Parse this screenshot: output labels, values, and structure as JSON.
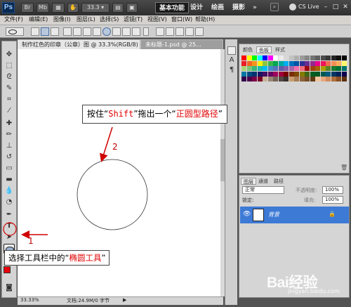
{
  "appbar": {
    "logo": "Ps",
    "zoom": "33.3",
    "workspaces": [
      "基本功能",
      "设计",
      "绘画",
      "摄影"
    ],
    "more": "»",
    "cslive": "CS Live"
  },
  "menubar": [
    "文件(F)",
    "编辑(E)",
    "图像(I)",
    "图层(L)",
    "选择(S)",
    "滤镜(T)",
    "视图(V)",
    "窗口(W)",
    "帮助(H)"
  ],
  "document": {
    "tab_active": "制作红色的印章（公章）图 @ 33.3%(RGB/8) *",
    "tab_inactive": "未标题-1.psd @ 25..."
  },
  "status": {
    "zoom": "33.33%",
    "doc_size": "文档:24.9M/0 字节"
  },
  "swatches_panel": {
    "tabs": [
      "颜色",
      "色板",
      "样式"
    ],
    "active_tab": "色板",
    "colors": [
      "#ff0000",
      "#ffff00",
      "#00ff00",
      "#00ffff",
      "#0000ff",
      "#ff00ff",
      "#ffffff",
      "#ebebeb",
      "#d7d7d7",
      "#c3c3c3",
      "#afafaf",
      "#9b9b9b",
      "#878787",
      "#737373",
      "#5f5f5f",
      "#4b4b4b",
      "#373737",
      "#232323",
      "#0f0f0f",
      "#000000",
      "#ed1c24",
      "#f26522",
      "#f7941d",
      "#fff200",
      "#8dc63f",
      "#39b54a",
      "#00a651",
      "#00a99d",
      "#00aeef",
      "#0072bc",
      "#0054a6",
      "#2e3192",
      "#662d91",
      "#92278f",
      "#ec008c",
      "#ed145b",
      "#f26c4f",
      "#f68e56",
      "#fbaf5d",
      "#fff568",
      "#acd373",
      "#7cc576",
      "#3bb878",
      "#1abbb4",
      "#00bff3",
      "#438ccb",
      "#5574b9",
      "#605ca8",
      "#855fa8",
      "#a763a9",
      "#f06ea9",
      "#f26d7d",
      "#9e0b0f",
      "#a0410d",
      "#a36209",
      "#aba000",
      "#598527",
      "#1a7b30",
      "#007236",
      "#00746b",
      "#0076a3",
      "#004a80",
      "#003471",
      "#1b1464",
      "#440e62",
      "#630460",
      "#9e005d",
      "#9e0039",
      "#790000",
      "#7b2e00",
      "#7d4900",
      "#827b00",
      "#406618",
      "#005e20",
      "#005826",
      "#005952",
      "#005b7f",
      "#003663",
      "#002157",
      "#0d004c",
      "#32004b",
      "#4b0049",
      "#7b0046",
      "#7a0026",
      "#c7b299",
      "#998675",
      "#736357",
      "#534741",
      "#37302d",
      "#c69c6d",
      "#a67c52",
      "#8c6239",
      "#754c24",
      "#603913",
      "#f2c6a0",
      "#e8a87c",
      "#d08c5c",
      "#b06e3c",
      "#8a4f22",
      "#5c3010"
    ]
  },
  "layers_panel": {
    "tabs": [
      "图层",
      "通道",
      "路径"
    ],
    "blend_mode": "正常",
    "opacity_label": "不透明度:",
    "opacity": "100%",
    "lock_label": "锁定:",
    "fill_label": "填充:",
    "fill": "100%",
    "layer_name": "背景"
  },
  "annotations": {
    "top_prefix": "按住“",
    "top_key": "Shift",
    "top_middle": "”拖出一个“",
    "top_highlight": "正圆型路径",
    "top_suffix": "”",
    "bottom_prefix": "选择工具栏中的“",
    "bottom_highlight": "椭圆工具",
    "bottom_suffix": "”",
    "step1": "1",
    "step2": "2"
  },
  "watermark": {
    "brand": "Bai经验",
    "url": "jingyan.baidu.com"
  },
  "colors": {
    "foreground": "#e8000b",
    "background": "#ffffff",
    "accent_red": "#e00000",
    "layer_selected": "#3d7ad6"
  }
}
